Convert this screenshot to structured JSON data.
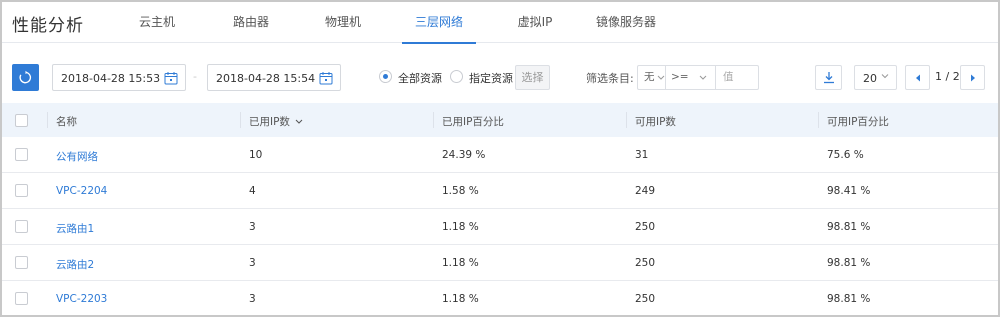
{
  "page": {
    "title": "性能分析"
  },
  "tabs": [
    {
      "label": "云主机"
    },
    {
      "label": "路由器"
    },
    {
      "label": "物理机"
    },
    {
      "label": "三层网络",
      "active": true
    },
    {
      "label": "虚拟IP"
    },
    {
      "label": "镜像服务器"
    }
  ],
  "toolbar": {
    "start_time": "2018-04-28 15:53",
    "end_time": "2018-04-28 15:54",
    "date_separator": "-",
    "scope_all": "全部资源",
    "scope_specified": "指定资源",
    "scope_selected": "all",
    "select_button": "选择",
    "filter_label": "筛选条目:",
    "filter_field": "无",
    "filter_operator": ">=",
    "filter_value_placeholder": "值",
    "page_size": "20",
    "page_info": "1 / 2"
  },
  "table": {
    "columns": [
      "名称",
      "已用IP数",
      "已用IP百分比",
      "可用IP数",
      "可用IP百分比"
    ],
    "sorted_column_indicator": "chevron-down-icon",
    "rows": [
      {
        "name": "公有网络",
        "used": "10",
        "used_pct": "24.39 %",
        "avail": "31",
        "avail_pct": "75.6 %"
      },
      {
        "name": "VPC-2204",
        "used": "4",
        "used_pct": "1.58 %",
        "avail": "249",
        "avail_pct": "98.41 %"
      },
      {
        "name": "云路由1",
        "used": "3",
        "used_pct": "1.18 %",
        "avail": "250",
        "avail_pct": "98.81 %"
      },
      {
        "name": "云路由2",
        "used": "3",
        "used_pct": "1.18 %",
        "avail": "250",
        "avail_pct": "98.81 %"
      },
      {
        "name": "VPC-2203",
        "used": "3",
        "used_pct": "1.18 %",
        "avail": "250",
        "avail_pct": "98.81 %"
      }
    ]
  },
  "colors": {
    "accent": "#2f7bd6",
    "header_bg": "#eef4fb",
    "border": "#dcdfe4"
  }
}
